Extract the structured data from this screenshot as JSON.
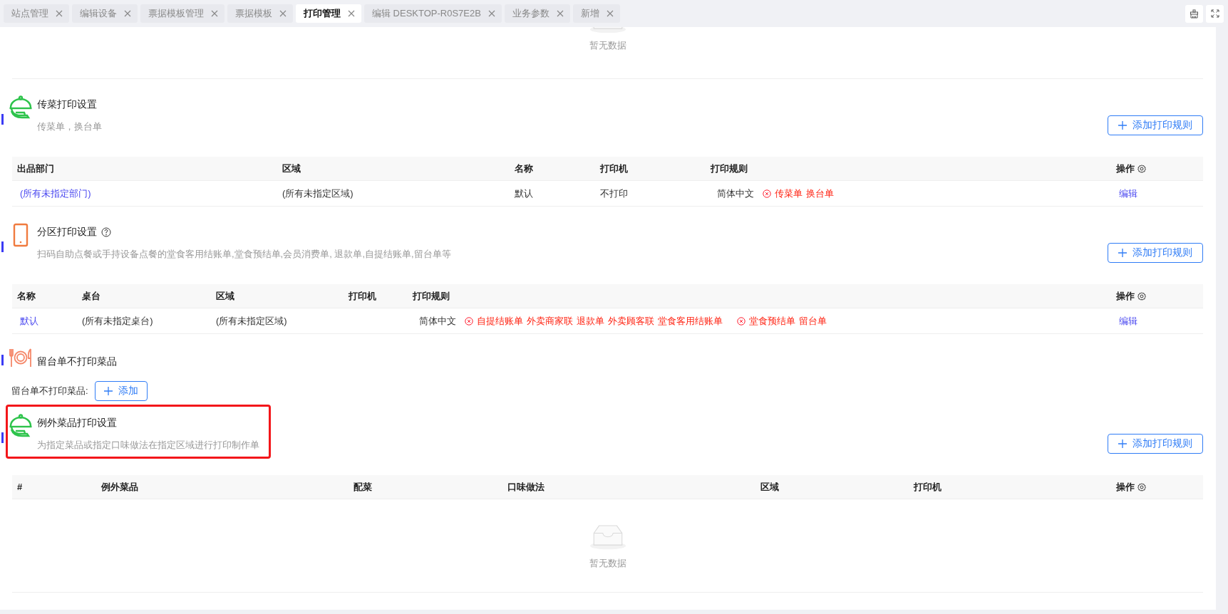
{
  "tabs": [
    {
      "label": "站点管理",
      "selected": false
    },
    {
      "label": "编辑设备",
      "selected": false
    },
    {
      "label": "票据模板管理",
      "selected": false
    },
    {
      "label": "票据模板",
      "selected": false
    },
    {
      "label": "打印管理",
      "selected": true
    },
    {
      "label": "编辑 DESKTOP-R0S7E2B",
      "selected": false
    },
    {
      "label": "业务参数",
      "selected": false
    },
    {
      "label": "新增",
      "selected": false
    }
  ],
  "top_empty": {
    "text": "暂无数据"
  },
  "sections": [
    {
      "kind": "table",
      "title": "传菜打印设置",
      "subtitle": "传菜单，换台单",
      "add_button": "添加打印规则",
      "table": {
        "columns": [
          {
            "label": "出品部门"
          },
          {
            "label": "区域"
          },
          {
            "label": "名称"
          },
          {
            "label": "打印机"
          },
          {
            "label": "打印规则"
          },
          {
            "label": "操作",
            "settings": true
          }
        ],
        "rows": [
          [
            {
              "kind": "link",
              "text": "(所有未指定部门)"
            },
            {
              "kind": "text",
              "text": "(所有未指定区域)"
            },
            {
              "kind": "text",
              "text": "默认"
            },
            {
              "kind": "text",
              "text": "不打印"
            },
            {
              "kind": "rules",
              "language": "简体中文",
              "groups": [
                [
                  "传菜单",
                  "换台单"
                ]
              ]
            },
            {
              "kind": "link",
              "text": "编辑"
            }
          ]
        ]
      }
    },
    {
      "kind": "table",
      "title": "分区打印设置",
      "help": true,
      "subtitle": "扫码自助点餐或手持设备点餐的堂食客用结账单,堂食预结单,会员消费单, 退款单,自提结账单,留台单等",
      "add_button": "添加打印规则",
      "table": {
        "columns": [
          {
            "label": "名称"
          },
          {
            "label": "桌台"
          },
          {
            "label": "区域"
          },
          {
            "label": "打印机"
          },
          {
            "label": "打印规则"
          },
          {
            "label": "操作",
            "settings": true
          }
        ],
        "rows": [
          [
            {
              "kind": "link",
              "text": "默认"
            },
            {
              "kind": "text",
              "text": "(所有未指定桌台)"
            },
            {
              "kind": "text",
              "text": "(所有未指定区域)"
            },
            {
              "kind": "empty"
            },
            {
              "kind": "rules",
              "language": "简体中文",
              "groups": [
                [
                  "自提结账单",
                  "外卖商家联",
                  "退款单",
                  "外卖顾客联",
                  "堂食客用结账单"
                ],
                [
                  "堂食预结单",
                  "留台单"
                ]
              ]
            },
            {
              "kind": "link",
              "text": "编辑"
            }
          ]
        ]
      }
    },
    {
      "kind": "picker",
      "title": "留台单不打印菜品",
      "field_label": "留台单不打印菜品:",
      "add_button": "添加"
    },
    {
      "kind": "table",
      "title": "例外菜品打印设置",
      "subtitle": "为指定菜品或指定口味做法在指定区域进行打印制作单",
      "highlighted": true,
      "add_button": "添加打印规则",
      "table": {
        "columns": [
          {
            "label": "#"
          },
          {
            "label": "例外菜品"
          },
          {
            "label": "配菜"
          },
          {
            "label": "口味做法"
          },
          {
            "label": "区域"
          },
          {
            "label": "打印机"
          },
          {
            "label": "操作",
            "settings": true
          }
        ],
        "empty_text": "暂无数据"
      }
    }
  ]
}
